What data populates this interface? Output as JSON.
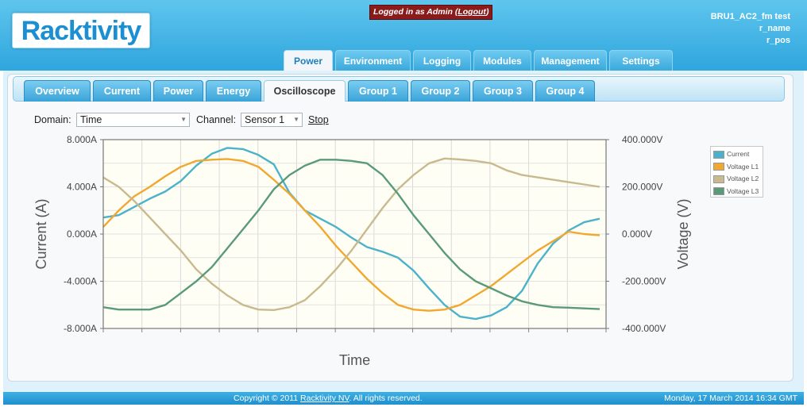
{
  "header": {
    "logo_text": "Racktivity",
    "login_prefix": "Logged in as Admin (",
    "logout_label": "Logout",
    "login_suffix": ")",
    "device_name": "BRU1_AC2_fm test",
    "device_rname": "r_name",
    "device_rpos": "r_pos"
  },
  "main_tabs": [
    {
      "label": "Power",
      "active": true
    },
    {
      "label": "Environment",
      "active": false
    },
    {
      "label": "Logging",
      "active": false
    },
    {
      "label": "Modules",
      "active": false
    },
    {
      "label": "Management",
      "active": false
    },
    {
      "label": "Settings",
      "active": false
    }
  ],
  "sub_tabs": [
    {
      "label": "Overview",
      "active": false
    },
    {
      "label": "Current",
      "active": false
    },
    {
      "label": "Power",
      "active": false
    },
    {
      "label": "Energy",
      "active": false
    },
    {
      "label": "Oscilloscope",
      "active": true
    },
    {
      "label": "Group 1",
      "active": false
    },
    {
      "label": "Group 2",
      "active": false
    },
    {
      "label": "Group 3",
      "active": false
    },
    {
      "label": "Group 4",
      "active": false
    }
  ],
  "controls": {
    "domain_label": "Domain:",
    "domain_value": "Time",
    "channel_label": "Channel:",
    "channel_value": "Sensor 1",
    "stop_label": "Stop"
  },
  "chart_data": {
    "type": "line",
    "xlabel": "Time",
    "ylabel_left": "Current (A)",
    "ylabel_right": "Voltage (V)",
    "left_ticks": [
      "8.000A",
      "4.000A",
      "0.000A",
      "-4.000A",
      "-8.000A"
    ],
    "right_ticks": [
      "400.000V",
      "200.000V",
      "0.000V",
      "-200.000V",
      "-400.000V"
    ],
    "ylim_left": [
      -8,
      8
    ],
    "ylim_right": [
      -400,
      400
    ],
    "xlim": [
      0,
      64
    ],
    "grid": true,
    "legend_position": "right",
    "series": [
      {
        "name": "Current",
        "axis": "left",
        "color": "#4bb3c9",
        "x": [
          0,
          2,
          4,
          6,
          8,
          10,
          12,
          14,
          16,
          18,
          20,
          22,
          24,
          26,
          28,
          30,
          32,
          34,
          36,
          38,
          40,
          42,
          44,
          46,
          48,
          50,
          52,
          54,
          56,
          58,
          60,
          62,
          64
        ],
        "y": [
          1.4,
          1.6,
          2.3,
          3.0,
          3.6,
          4.5,
          5.8,
          6.8,
          7.3,
          7.2,
          6.7,
          5.9,
          3.5,
          2.0,
          1.3,
          0.6,
          -0.3,
          -1.1,
          -1.5,
          -2.0,
          -3.1,
          -4.6,
          -6.0,
          -7.0,
          -7.2,
          -6.9,
          -6.2,
          -4.8,
          -2.5,
          -0.8,
          0.3,
          1.0,
          1.3
        ]
      },
      {
        "name": "Voltage L1",
        "axis": "right",
        "color": "#f0a830",
        "x": [
          0,
          2,
          4,
          6,
          8,
          10,
          12,
          14,
          16,
          18,
          20,
          22,
          24,
          26,
          28,
          30,
          32,
          34,
          36,
          38,
          40,
          42,
          44,
          46,
          48,
          50,
          52,
          54,
          56,
          58,
          60,
          62,
          64
        ],
        "y": [
          30,
          100,
          160,
          200,
          245,
          285,
          310,
          315,
          318,
          310,
          285,
          230,
          170,
          100,
          30,
          -50,
          -120,
          -190,
          -250,
          -300,
          -320,
          -325,
          -320,
          -300,
          -260,
          -220,
          -170,
          -120,
          -70,
          -30,
          10,
          0,
          -5
        ]
      },
      {
        "name": "Voltage L2",
        "axis": "right",
        "color": "#c8b98f",
        "x": [
          0,
          2,
          4,
          6,
          8,
          10,
          12,
          14,
          16,
          18,
          20,
          22,
          24,
          26,
          28,
          30,
          32,
          34,
          36,
          38,
          40,
          42,
          44,
          46,
          48,
          50,
          52,
          54,
          56,
          58,
          60,
          62,
          64
        ],
        "y": [
          240,
          200,
          140,
          70,
          0,
          -70,
          -150,
          -210,
          -260,
          -300,
          -320,
          -322,
          -310,
          -280,
          -220,
          -150,
          -70,
          20,
          110,
          190,
          250,
          300,
          320,
          316,
          310,
          300,
          270,
          250,
          240,
          230,
          220,
          210,
          200
        ]
      },
      {
        "name": "Voltage L3",
        "axis": "right",
        "color": "#5a9a78",
        "x": [
          0,
          2,
          4,
          6,
          8,
          10,
          12,
          14,
          16,
          18,
          20,
          22,
          24,
          26,
          28,
          30,
          32,
          34,
          36,
          38,
          40,
          42,
          44,
          46,
          48,
          50,
          52,
          54,
          56,
          58,
          60,
          62,
          64
        ],
        "y": [
          -310,
          -320,
          -320,
          -320,
          -300,
          -250,
          -200,
          -140,
          -60,
          20,
          100,
          190,
          250,
          290,
          315,
          315,
          310,
          300,
          250,
          170,
          80,
          0,
          -80,
          -150,
          -200,
          -230,
          -260,
          -285,
          -300,
          -310,
          -312,
          -315,
          -318
        ]
      }
    ]
  },
  "footer": {
    "copyright_prefix": "Copyright © 2011 ",
    "copyright_link": "Racktivity NV",
    "copyright_suffix": ". All rights reserved.",
    "datetime": "Monday, 17 March 2014 16:34 GMT"
  }
}
